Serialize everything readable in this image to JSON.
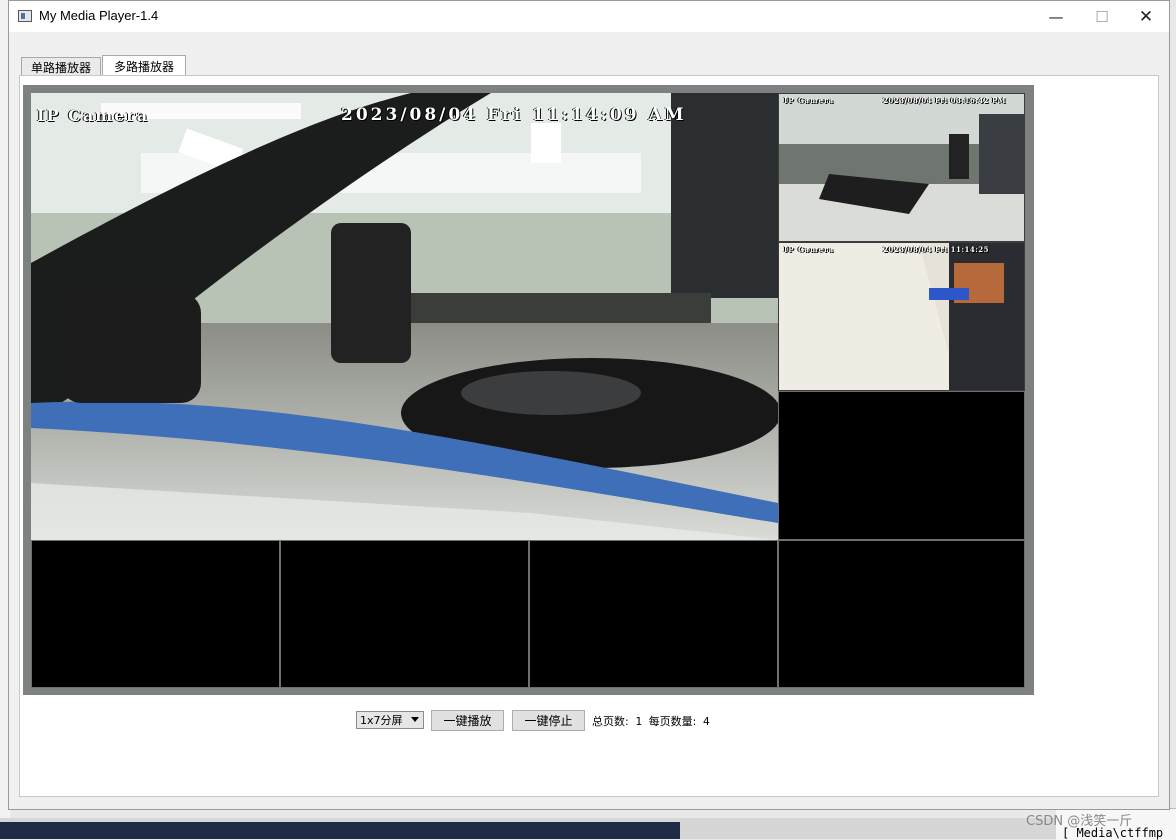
{
  "window": {
    "title": "My Media Player-1.4",
    "controls": {
      "minimize": "—",
      "maximize": "☐",
      "close": "✕"
    }
  },
  "tabs": [
    {
      "label": "单路播放器",
      "selected": false
    },
    {
      "label": "多路播放器",
      "selected": true
    }
  ],
  "video_grid": {
    "main": {
      "camera_name": "IP Camera",
      "timestamp": "2023/08/04 Fri 11:14:09 AM"
    },
    "side": [
      {
        "camera_name": "IP Camera",
        "timestamp": "2023/08/04 Fri 03:16:42 PM"
      },
      {
        "camera_name": "IP Camera",
        "timestamp": "2023/08/04 Fri 11:14:25"
      }
    ],
    "empty_cells": 5
  },
  "controls": {
    "layout_select": "1x7分屏",
    "play_all_label": "一键播放",
    "stop_all_label": "一键停止",
    "total_pages_label": "总页数:",
    "total_pages_value": "1",
    "per_page_label": "每页数量:",
    "per_page_value": "4"
  },
  "watermark": "CSDN @浅笑一斤",
  "background_text": "[ Media\\ctffmp"
}
